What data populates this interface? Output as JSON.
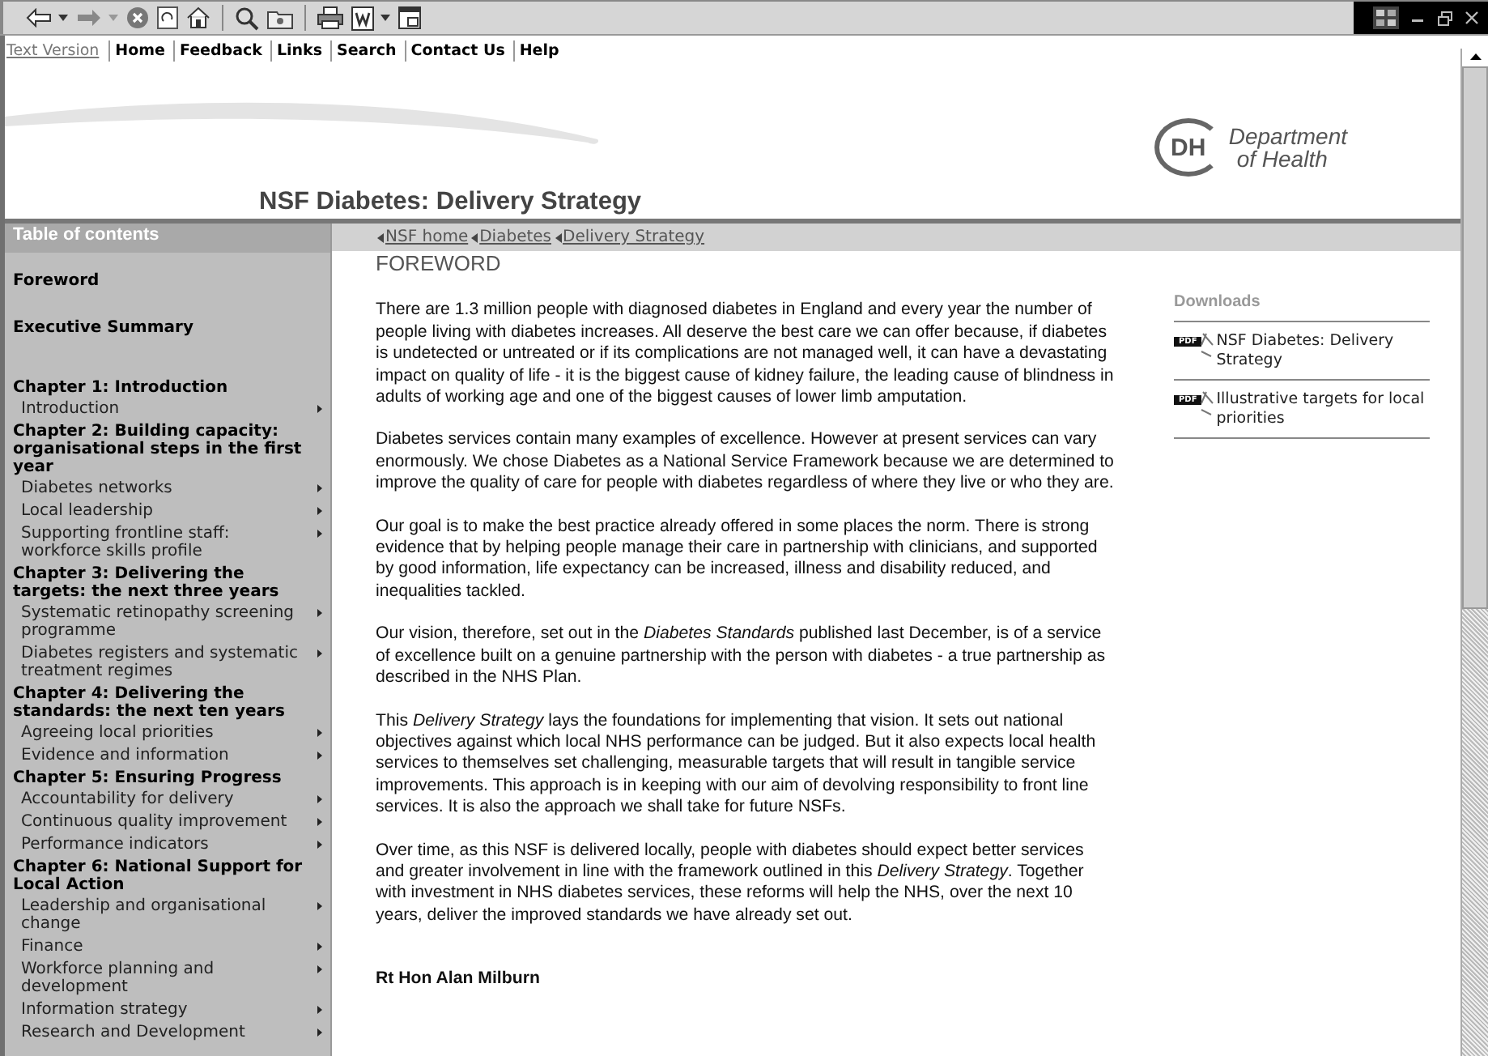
{
  "nav_links": [
    {
      "label": "Text Version",
      "kind": "plain"
    },
    {
      "label": "Home",
      "kind": "bold"
    },
    {
      "label": "Feedback",
      "kind": "bold"
    },
    {
      "label": "Links",
      "kind": "bold"
    },
    {
      "label": "Search",
      "kind": "bold"
    },
    {
      "label": "Contact Us",
      "kind": "bold"
    },
    {
      "label": "Help",
      "kind": "bold"
    }
  ],
  "page_title": "NSF Diabetes: Delivery Strategy",
  "logo": {
    "initials": "DH",
    "name_line_1": "Department",
    "name_line_2": "of Health"
  },
  "sidebar": {
    "title": "Table of contents",
    "sections": [
      {
        "title": "Foreword"
      },
      {
        "title": "Executive Summary"
      },
      {
        "title": "Chapter 1: Introduction",
        "children": [
          {
            "label": "Introduction"
          }
        ]
      },
      {
        "title": "Chapter 2: Building capacity: organisational steps in the first year",
        "children": [
          {
            "label": "Diabetes networks"
          },
          {
            "label": "Local leadership"
          },
          {
            "label": "Supporting frontline staff: workforce skills profile"
          }
        ]
      },
      {
        "title": "Chapter 3: Delivering the targets: the next three years",
        "children": [
          {
            "label": "Systematic retinopathy screening programme"
          },
          {
            "label": "Diabetes registers and systematic treatment regimes"
          }
        ]
      },
      {
        "title": "Chapter 4: Delivering the standards: the next ten years",
        "children": [
          {
            "label": "Agreeing local priorities"
          },
          {
            "label": "Evidence and information"
          }
        ]
      },
      {
        "title": "Chapter 5: Ensuring Progress",
        "children": [
          {
            "label": "Accountability for delivery"
          },
          {
            "label": "Continuous quality improvement"
          },
          {
            "label": "Performance indicators"
          }
        ]
      },
      {
        "title": "Chapter 6: National Support for Local Action",
        "children": [
          {
            "label": "Leadership and organisational change"
          },
          {
            "label": "Finance"
          },
          {
            "label": "Workforce planning and development"
          },
          {
            "label": "Information strategy"
          },
          {
            "label": "Research and Development"
          }
        ]
      }
    ]
  },
  "breadcrumb": [
    "NSF home",
    "Diabetes",
    "Delivery Strategy"
  ],
  "heading": "FOREWORD",
  "paragraphs": [
    "There are 1.3 million people with diagnosed diabetes in England and every year the number of people living with diabetes increases. All deserve the best care we can offer because, if diabetes is undetected or untreated or if its complications are not managed well, it can have a devastating impact on quality of life - it is the biggest cause of kidney failure, the leading cause of blindness in adults of working age and one of the biggest causes of lower limb amputation.",
    "Diabetes services contain many examples of excellence. However at present services can vary enormously. We chose Diabetes as a National Service Framework because we are determined to improve the quality of care for people with diabetes regardless of where they live or who they are.",
    "Our goal is to make the best practice already offered in some places the norm. There is strong evidence that by helping people manage their care in partnership with clinicians, and supported by good information, life expectancy can be increased, illness and disability reduced, and inequalities tackled.",
    "Our vision, therefore, set out in the *Diabetes Standards* published last December, is of a service of excellence built on a genuine partnership with the person with diabetes - a true partnership as described in the NHS Plan.",
    "This *Delivery Strategy* lays the foundations for implementing that vision. It sets out national objectives against which local NHS performance can be judged. But it also expects local health services to themselves set challenging, measurable targets that will result in tangible service improvements. This approach is in keeping with our aim of devolving responsibility to front line services. It is also the approach we shall take for future NSFs.",
    "Over time, as this NSF is delivered locally, people with diabetes should expect better services and greater involvement in line with the framework outlined in this *Delivery Strategy*. Together with investment in NHS diabetes services, these reforms will help the NHS, over the next 10 years, deliver the improved standards we have already set out."
  ],
  "signature": "Rt Hon Alan Milburn",
  "downloads": {
    "title": "Downloads",
    "items": [
      {
        "badge": "PDF",
        "label": "NSF Diabetes: Delivery Strategy"
      },
      {
        "badge": "PDF",
        "label": "Illustrative targets for local priorities"
      }
    ]
  }
}
